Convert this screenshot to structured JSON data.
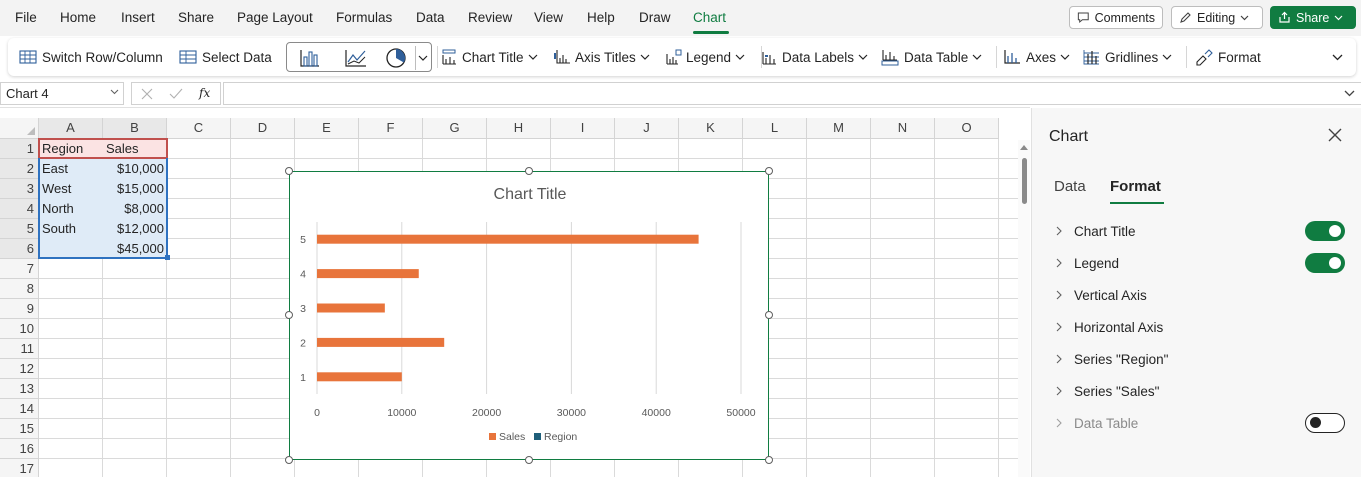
{
  "menu": {
    "tabs": [
      {
        "label": "File"
      },
      {
        "label": "Home"
      },
      {
        "label": "Insert"
      },
      {
        "label": "Share"
      },
      {
        "label": "Page Layout"
      },
      {
        "label": "Formulas"
      },
      {
        "label": "Data"
      },
      {
        "label": "Review"
      },
      {
        "label": "View"
      },
      {
        "label": "Help"
      },
      {
        "label": "Draw"
      },
      {
        "label": "Chart"
      }
    ],
    "active_tab": "Chart",
    "comments_label": "Comments",
    "editing_label": "Editing",
    "share_label": "Share"
  },
  "ribbon": {
    "switch_row_column": "Switch Row/Column",
    "select_data": "Select Data",
    "chart_title": "Chart Title",
    "axis_titles": "Axis Titles",
    "legend": "Legend",
    "data_labels": "Data Labels",
    "data_table": "Data Table",
    "axes": "Axes",
    "gridlines": "Gridlines",
    "format": "Format"
  },
  "formula_bar": {
    "name_box": "Chart 4",
    "fx": "fx",
    "value": ""
  },
  "sheet": {
    "columns": [
      "A",
      "B",
      "C",
      "D",
      "E",
      "F",
      "G",
      "H",
      "I",
      "J",
      "K",
      "L",
      "M",
      "N",
      "O"
    ],
    "rows": [
      "1",
      "2",
      "3",
      "4",
      "5",
      "6",
      "7",
      "8",
      "9",
      "10",
      "11",
      "12",
      "13",
      "14",
      "15",
      "16",
      "17"
    ],
    "cells": {
      "A1": "Region",
      "B1": "Sales",
      "A2": "East",
      "B2": "$10,000",
      "A3": "West",
      "B3": "$15,000",
      "A4": "North",
      "B4": "$8,000",
      "A5": "South",
      "B5": "$12,000",
      "B6": "$45,000"
    }
  },
  "chart_data": {
    "type": "bar",
    "orientation": "horizontal",
    "title": "Chart Title",
    "categories": [
      "1",
      "2",
      "3",
      "4",
      "5"
    ],
    "series": [
      {
        "name": "Sales",
        "values": [
          10000,
          15000,
          8000,
          12000,
          45000
        ],
        "color": "#e8743b"
      }
    ],
    "legend": [
      {
        "name": "Sales",
        "color": "#e8743b"
      },
      {
        "name": "Region",
        "color": "#1f5f7a"
      }
    ],
    "legend_position": "bottom",
    "xlim": [
      0,
      50000
    ],
    "x_ticks": [
      "0",
      "10000",
      "20000",
      "30000",
      "40000",
      "50000"
    ],
    "grid": true
  },
  "panel": {
    "title": "Chart",
    "tabs": [
      {
        "label": "Data"
      },
      {
        "label": "Format"
      }
    ],
    "active_tab": "Format",
    "items": [
      {
        "label": "Chart Title",
        "toggle": "on"
      },
      {
        "label": "Legend",
        "toggle": "on"
      },
      {
        "label": "Vertical Axis"
      },
      {
        "label": "Horizontal Axis"
      },
      {
        "label": "Series \"Region\""
      },
      {
        "label": "Series \"Sales\""
      },
      {
        "label": "Data Table",
        "toggle": "off",
        "disabled": true
      }
    ]
  },
  "colors": {
    "accent": "#107c41",
    "bar": "#e8743b",
    "region": "#1f5f7a"
  }
}
